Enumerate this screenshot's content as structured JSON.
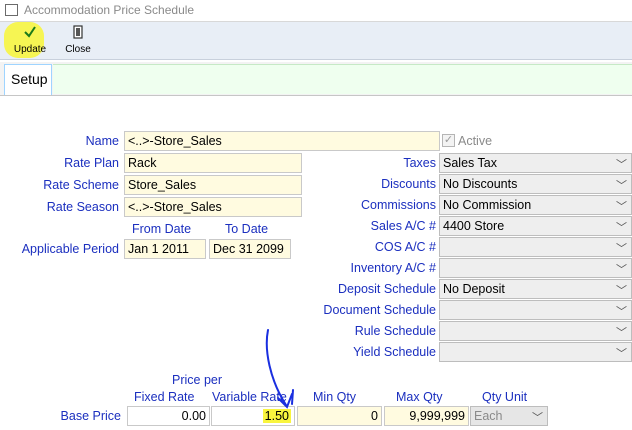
{
  "window": {
    "title": "Accommodation Price Schedule"
  },
  "toolbar": {
    "update_label": "Update",
    "update_icon": "check-icon",
    "close_label": "Close",
    "close_icon": "door-icon"
  },
  "tabs": [
    {
      "label": "Setup",
      "active": true
    }
  ],
  "form": {
    "name_label": "Name",
    "name_value": "<..>-Store_Sales",
    "active_label": "Active",
    "active_checked": true,
    "rate_plan_label": "Rate Plan",
    "rate_plan_value": "Rack",
    "rate_scheme_label": "Rate Scheme",
    "rate_scheme_value": "Store_Sales",
    "rate_season_label": "Rate Season",
    "rate_season_value": "<..>-Store_Sales",
    "from_date_label": "From Date",
    "to_date_label": "To Date",
    "applicable_period_label": "Applicable Period",
    "from_date_value": "Jan 1 2011",
    "to_date_value": "Dec 31 2099"
  },
  "right_fields": [
    {
      "label": "Taxes",
      "value": "Sales Tax"
    },
    {
      "label": "Discounts",
      "value": "No Discounts"
    },
    {
      "label": "Commissions",
      "value": "No Commission"
    },
    {
      "label": "Sales A/C #",
      "value": "4400 Store"
    },
    {
      "label": "COS A/C #",
      "value": ""
    },
    {
      "label": "Inventory A/C #",
      "value": ""
    },
    {
      "label": "Deposit Schedule",
      "value": "No Deposit"
    },
    {
      "label": "Document Schedule",
      "value": ""
    },
    {
      "label": "Rule Schedule",
      "value": ""
    },
    {
      "label": "Yield Schedule",
      "value": ""
    }
  ],
  "price_grid": {
    "price_per_label": "Price per",
    "headers": [
      "Fixed Rate",
      "Variable Rate",
      "Min Qty",
      "Max Qty",
      "Qty Unit"
    ],
    "row_label": "Base Price",
    "fixed_rate": "0.00",
    "variable_rate": "1.50",
    "min_qty": "0",
    "max_qty": "9,999,999",
    "qty_unit": "Each"
  },
  "colors": {
    "label_blue": "#1b2fbf",
    "field_yellow": "#fffbe0",
    "highlight_yellow": "#f9f53e",
    "annotation_blue": "#1a2fe0"
  }
}
